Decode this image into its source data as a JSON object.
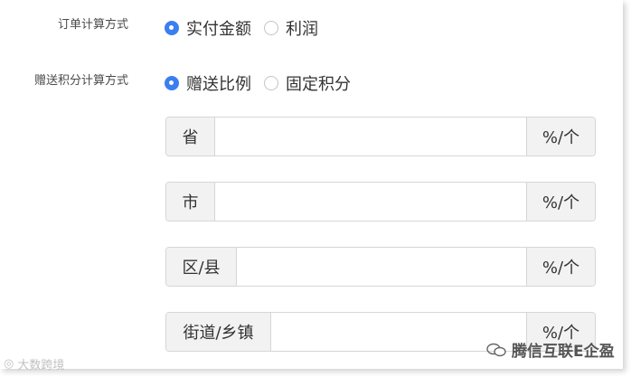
{
  "order_calc": {
    "label": "订单计算方式",
    "options": [
      {
        "label": "实付金额",
        "checked": true
      },
      {
        "label": "利润",
        "checked": false
      }
    ]
  },
  "points_calc": {
    "label": "赠送积分计算方式",
    "options": [
      {
        "label": "赠送比例",
        "checked": true
      },
      {
        "label": "固定积分",
        "checked": false
      }
    ]
  },
  "rates": [
    {
      "prefix": "省",
      "value": "",
      "suffix": "%/个"
    },
    {
      "prefix": "市",
      "value": "",
      "suffix": "%/个"
    },
    {
      "prefix": "区/县",
      "value": "",
      "suffix": "%/个"
    },
    {
      "prefix": "街道/乡镇",
      "value": "",
      "suffix": "%/个"
    }
  ],
  "watermark": {
    "left": "大数跨境",
    "right": "腾信互联E企盈"
  },
  "colors": {
    "accent": "#3b7ef0",
    "addon_bg": "#f2f2f2",
    "border": "#d6d6d6"
  }
}
